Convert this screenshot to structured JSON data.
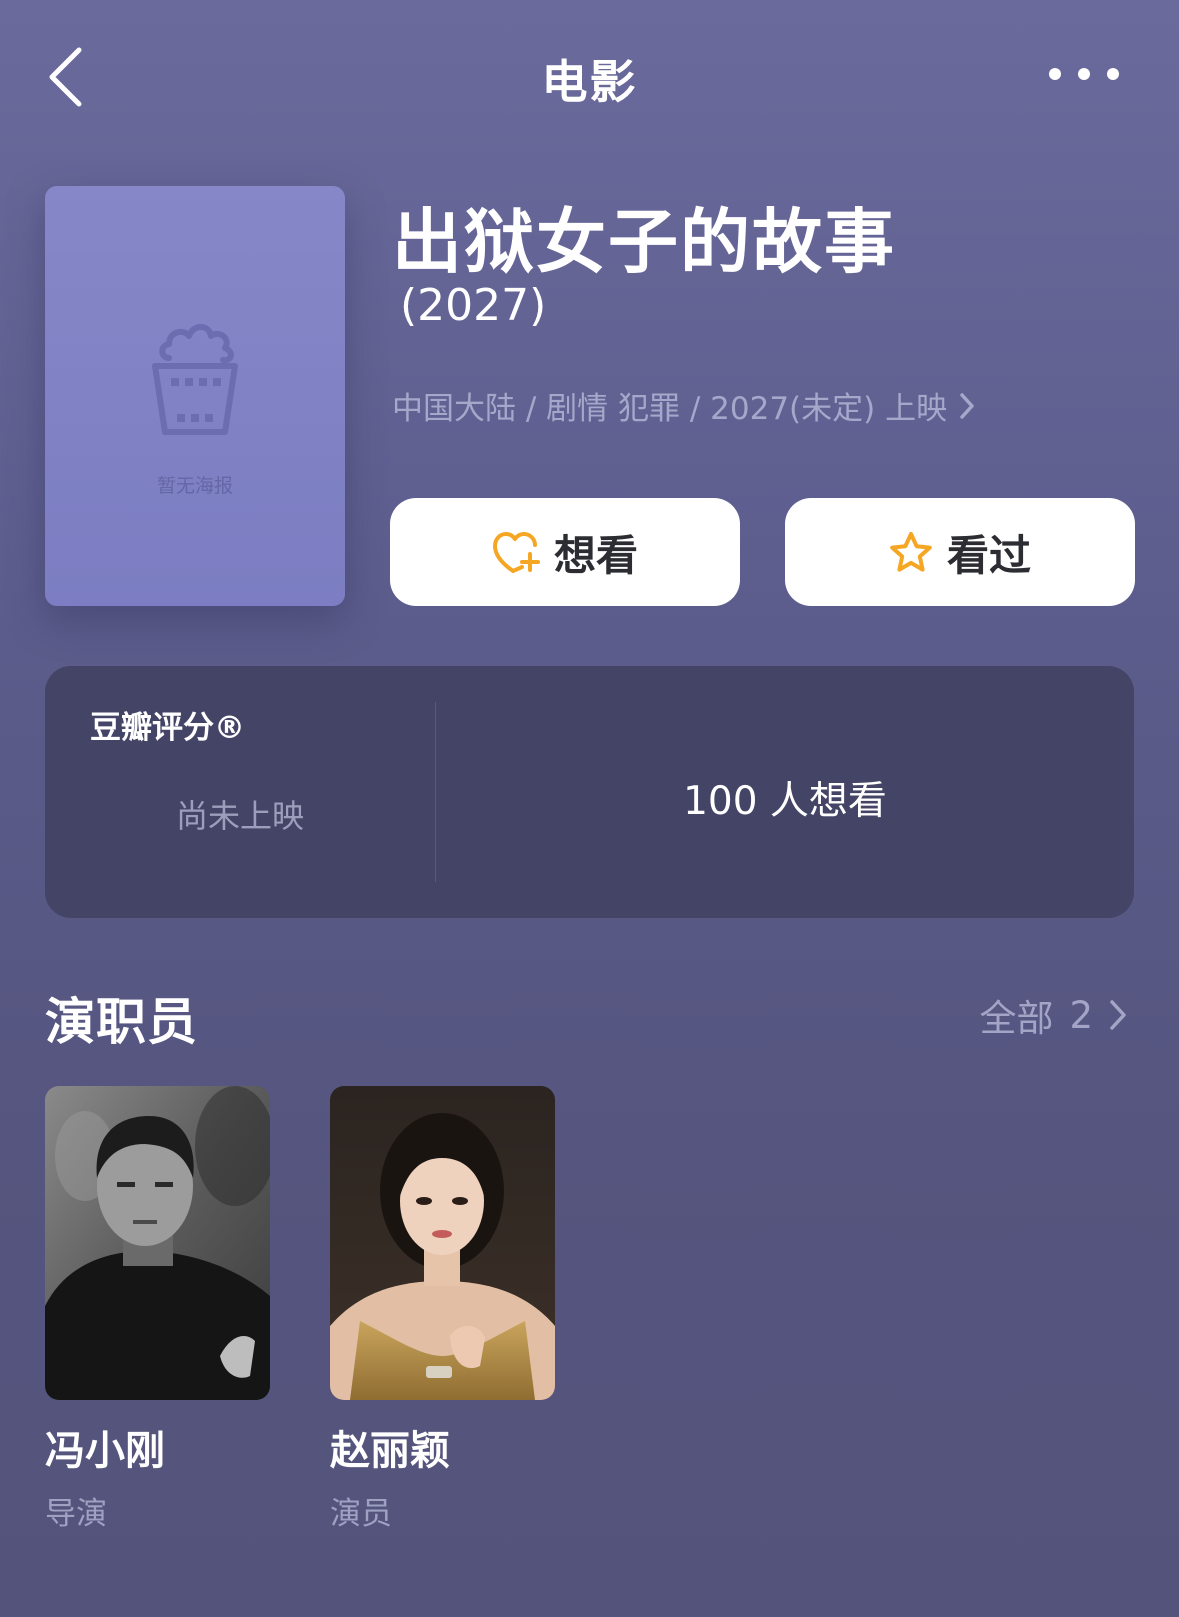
{
  "nav": {
    "title": "电影",
    "back_icon": "chevron-left-icon",
    "more_icon": "more-dots-icon"
  },
  "poster": {
    "empty_label": "暂无海报",
    "icon": "popcorn-icon"
  },
  "movie": {
    "title": "出狱女子的故事",
    "year": "(2027)",
    "meta": "中国大陆 / 剧情 犯罪 / 2027(未定) 上映"
  },
  "actions": {
    "want_label": "想看",
    "want_icon": "heart-plus-icon",
    "seen_label": "看过",
    "seen_icon": "star-icon",
    "icon_color": "#f5a623"
  },
  "rating": {
    "label": "豆瓣评分®",
    "status": "尚未上映",
    "want_count": "100 人想看"
  },
  "cast": {
    "title": "演职员",
    "all_label": "全部",
    "all_count": "2",
    "members": [
      {
        "name": "冯小刚",
        "role": "导演"
      },
      {
        "name": "赵丽颖",
        "role": "演员"
      }
    ]
  },
  "colors": {
    "background": "#5d5d8e",
    "card": "#444466",
    "poster": "#8183c5"
  }
}
